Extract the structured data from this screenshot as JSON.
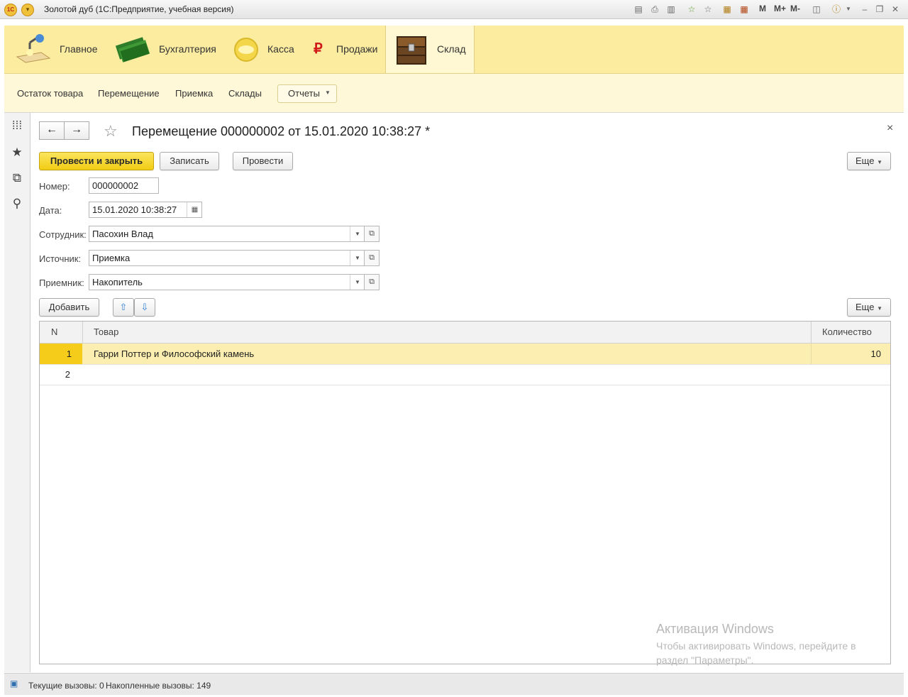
{
  "window": {
    "title": "Золотой дуб  (1С:Предприятие, учебная версия)",
    "logo_text": "1С",
    "toolbar_text": {
      "m": "M",
      "m_plus": "M+",
      "m_minus": "M-"
    }
  },
  "sections": [
    {
      "label": "Главное",
      "icon": "desk-lamp-icon"
    },
    {
      "label": "Бухгалтерия",
      "icon": "money-stack-icon"
    },
    {
      "label": "Касса",
      "icon": "coin-icon"
    },
    {
      "label": "Продажи",
      "icon": "ruble-icon",
      "symbol": "₽"
    },
    {
      "label": "Склад",
      "icon": "chest-icon",
      "active": true
    }
  ],
  "commands": {
    "items": [
      "Остаток товара",
      "Перемещение",
      "Приемка",
      "Склады"
    ],
    "reports_label": "Отчеты"
  },
  "form": {
    "title": "Перемещение 000000002 от 15.01.2020 10:38:27 *",
    "buttons": {
      "post_close": "Провести и закрыть",
      "save": "Записать",
      "post": "Провести",
      "more": "Еще"
    },
    "fields": {
      "number": {
        "label": "Номер:",
        "value": "000000002"
      },
      "date": {
        "label": "Дата:",
        "value": "15.01.2020 10:38:27"
      },
      "employee": {
        "label": "Сотрудник:",
        "value": "Пасохин Влад"
      },
      "source": {
        "label": "Источник:",
        "value": "Приемка"
      },
      "receiver": {
        "label": "Приемник:",
        "value": "Накопитель"
      }
    },
    "table": {
      "add_label": "Добавить",
      "more_label": "Еще",
      "columns": {
        "n": "N",
        "item": "Товар",
        "qty": "Количество"
      },
      "rows": [
        {
          "n": "1",
          "item": "Гарри Поттер и Философский камень",
          "qty": "10"
        },
        {
          "n": "2",
          "item": "",
          "qty": ""
        }
      ]
    }
  },
  "watermark": {
    "title": "Активация Windows",
    "text": "Чтобы активировать Windows, перейдите в раздел \"Параметры\"."
  },
  "status": {
    "current_calls": "Текущие вызовы: 0",
    "accumulated_calls": "Накопленные вызовы: 149"
  },
  "colors": {
    "section_bg": "#fbeca0",
    "command_bg": "#fef8d8",
    "primary_button": "#f2cd14",
    "selected_row": "#fbeeb0"
  }
}
